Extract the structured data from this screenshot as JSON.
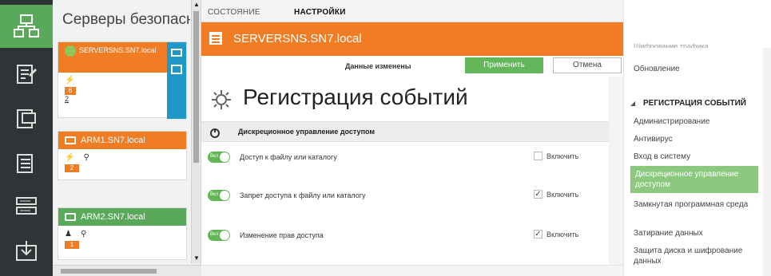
{
  "colors": {
    "orange": "#f07c23",
    "green": "#64b65a",
    "rail": "#2f3437",
    "selected_nav": "#8cc97e"
  },
  "rail": {
    "icons": [
      "network-icon",
      "policy-icon",
      "computer-icon",
      "server-icon",
      "rack-icon",
      "import-icon"
    ],
    "active_index": 0
  },
  "servers": {
    "title": "Серверы безопасн",
    "cards": [
      {
        "name": "SERVERSNS.SN7.local",
        "header_color": "#f07c23",
        "counts": [
          "6",
          "2"
        ]
      },
      {
        "name": "ARM1.SN7.local",
        "header_color": "#f07c23",
        "counts": [
          "2"
        ]
      },
      {
        "name": "ARM2.SN7.local",
        "header_color": "#5aa95a",
        "counts": [
          "1"
        ]
      }
    ]
  },
  "tabs": [
    {
      "label": "Состояние",
      "active": false
    },
    {
      "label": "Настройки",
      "active": true
    }
  ],
  "server_header": {
    "title": "SERVERSNS.SN7.local"
  },
  "actions": {
    "changed_message": "Данные изменены",
    "apply_label": "Применить",
    "cancel_label": "Отмена"
  },
  "page": {
    "heading": "Регистрация событий",
    "section_title": "Дискреционное управление доступом",
    "toggle_label": "Вкл",
    "checkbox_label": "Включить",
    "rows": [
      {
        "label": "Доступ к файлу или каталогу",
        "checked": false
      },
      {
        "label": "Запрет доступа к файлу или каталогу",
        "checked": true
      },
      {
        "label": "Изменение прав доступа",
        "checked": true
      }
    ]
  },
  "rightnav": {
    "items_top": [
      "Шифрование трафика",
      "Обновление"
    ],
    "section": "Регистрация событий",
    "items": [
      "Администрирование",
      "Антивирус",
      "Вход в систему",
      "Дискреционное управление доступом",
      "Замкнутая программная среда",
      "Затирание данных",
      "Защита диска и шифрование данных"
    ],
    "selected_index": 3
  }
}
